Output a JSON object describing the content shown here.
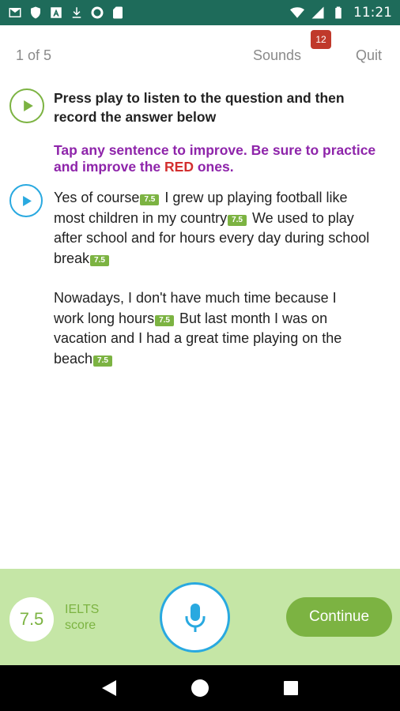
{
  "status_bar": {
    "time": "11:21",
    "left_icons": [
      "gmail-icon",
      "shield-icon",
      "app-a-icon",
      "download-icon",
      "circle-icon",
      "sim-icon"
    ],
    "right_icons": [
      "wifi-icon",
      "signal-icon",
      "battery-icon"
    ]
  },
  "header": {
    "progress": "1 of 5",
    "sounds_label": "Sounds",
    "sounds_badge": "12",
    "quit_label": "Quit"
  },
  "question": {
    "text": "Press play to listen to the question and then record the answer below"
  },
  "instruction": {
    "before": "Tap any sentence to improve. Be sure to practice and improve the ",
    "highlight": "RED",
    "after": " ones."
  },
  "answer": {
    "paragraphs": [
      {
        "sentences": [
          {
            "text": "Yes of course",
            "score": "7.5"
          },
          {
            "text": " I grew up playing football like most children in my country",
            "score": "7.5"
          },
          {
            "text": " We used to play after school and for hours every day during school break",
            "score": "7.5"
          }
        ]
      },
      {
        "sentences": [
          {
            "text": "Nowadays, I don't have much time because I work long hours",
            "score": "7.5"
          },
          {
            "text": " But last month I was on vacation and I had a great time playing on the beach",
            "score": "7.5"
          }
        ]
      }
    ]
  },
  "footer": {
    "score": "7.5",
    "score_label_line1": "IELTS",
    "score_label_line2": "score",
    "continue_label": "Continue"
  },
  "colors": {
    "green": "#7cb342",
    "blue": "#29a9e0",
    "purple": "#8e24aa",
    "red": "#d32f2f",
    "panel": "#c5e6a6",
    "status_bar": "#1e6b5a"
  }
}
